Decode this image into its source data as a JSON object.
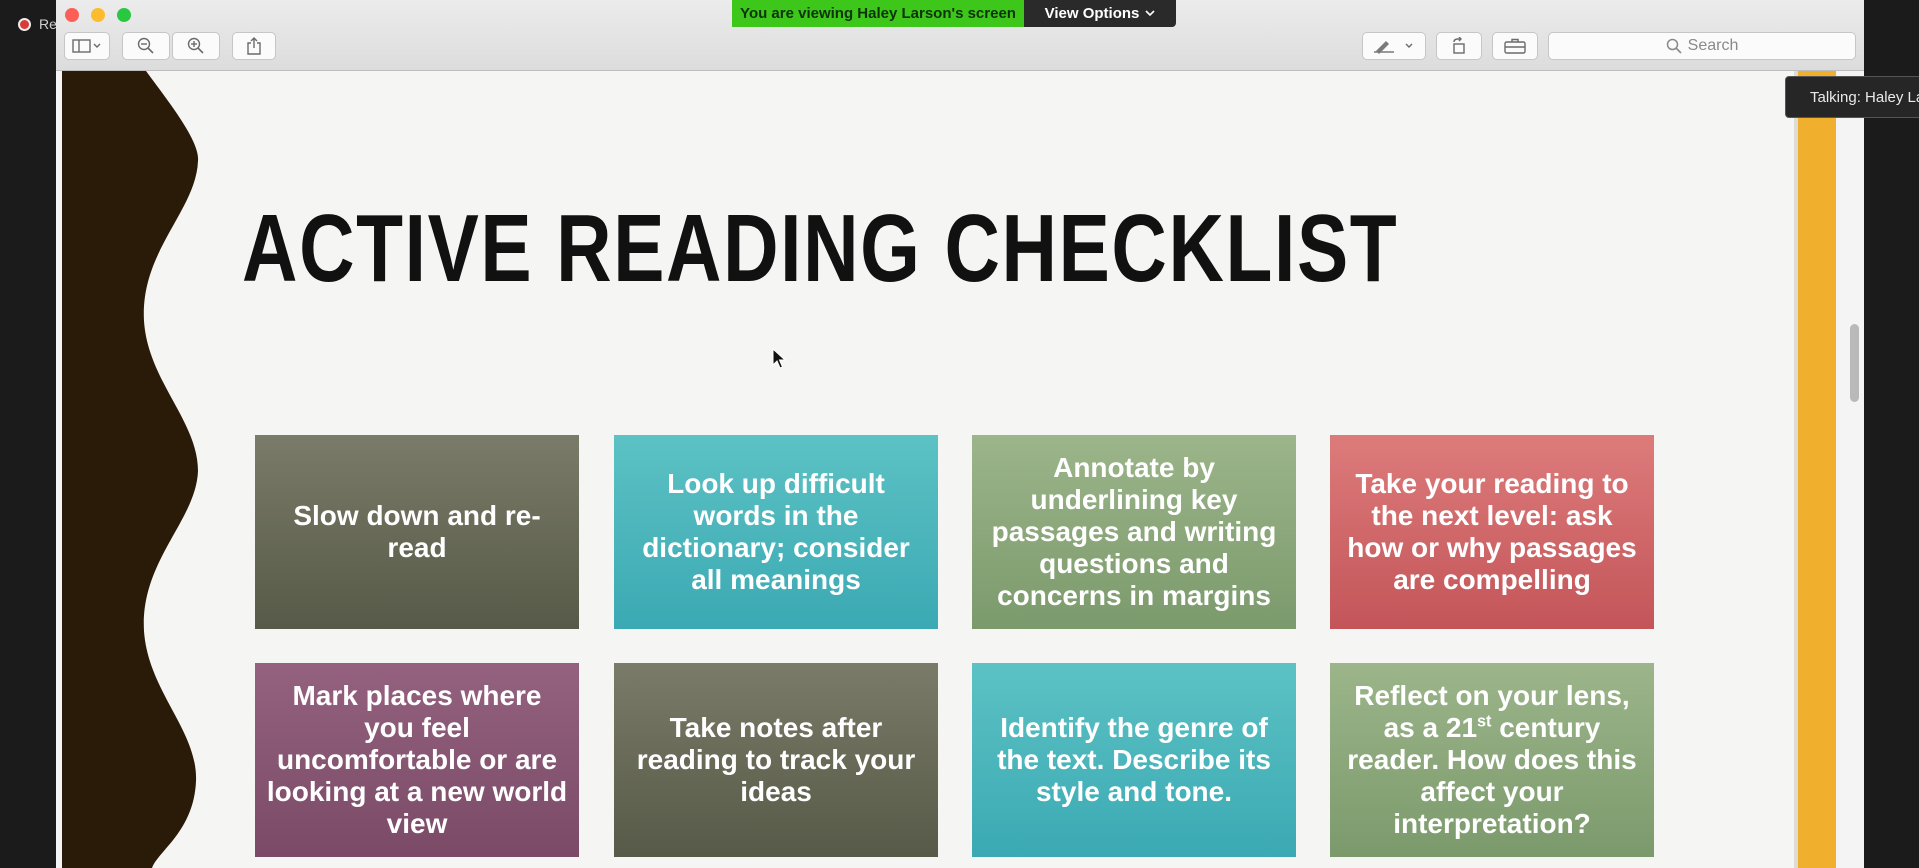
{
  "recording": {
    "label": "Recording"
  },
  "share_banner": {
    "viewing_text": "You are viewing Haley Larson's screen",
    "view_options_label": "View Options",
    "colors": {
      "banner": "#3ec71b",
      "options": "#2a2a2a"
    }
  },
  "toolbar": {
    "search_placeholder": "Search",
    "icons": [
      "sidebar-toggle-icon",
      "zoom-out-icon",
      "zoom-in-icon",
      "share-icon",
      "markup-icon",
      "rotate-icon",
      "toolbox-icon"
    ]
  },
  "slide": {
    "title": "ACTIVE READING CHECKLIST",
    "cards": [
      {
        "text": "Slow down and re-read",
        "color": "#6a6b59"
      },
      {
        "text": "Look up difficult words in the dictionary; consider all meanings",
        "color": "#4cb6bc"
      },
      {
        "text": "Annotate by underlining key passages and writing questions and concerns in margins",
        "color": "#8ca87b"
      },
      {
        "text": "Take your reading to the next level: ask how or why passages are compelling",
        "color": "#d06869"
      },
      {
        "text": "Mark places where you feel uncomfortable or are looking at a new world view",
        "color": "#875673"
      },
      {
        "text": "Take notes after reading to track your ideas",
        "color": "#6a6b59"
      },
      {
        "text": "Identify the genre of the text. Describe its style and tone.",
        "color": "#4cb6bc"
      },
      {
        "text_before": "Reflect on your lens, as a 21",
        "text_sup": "st",
        "text_after": " century reader. How does this affect your interpretation?",
        "color": "#8ca87b"
      }
    ]
  },
  "talking_indicator": {
    "text": "Talking: Haley La"
  }
}
